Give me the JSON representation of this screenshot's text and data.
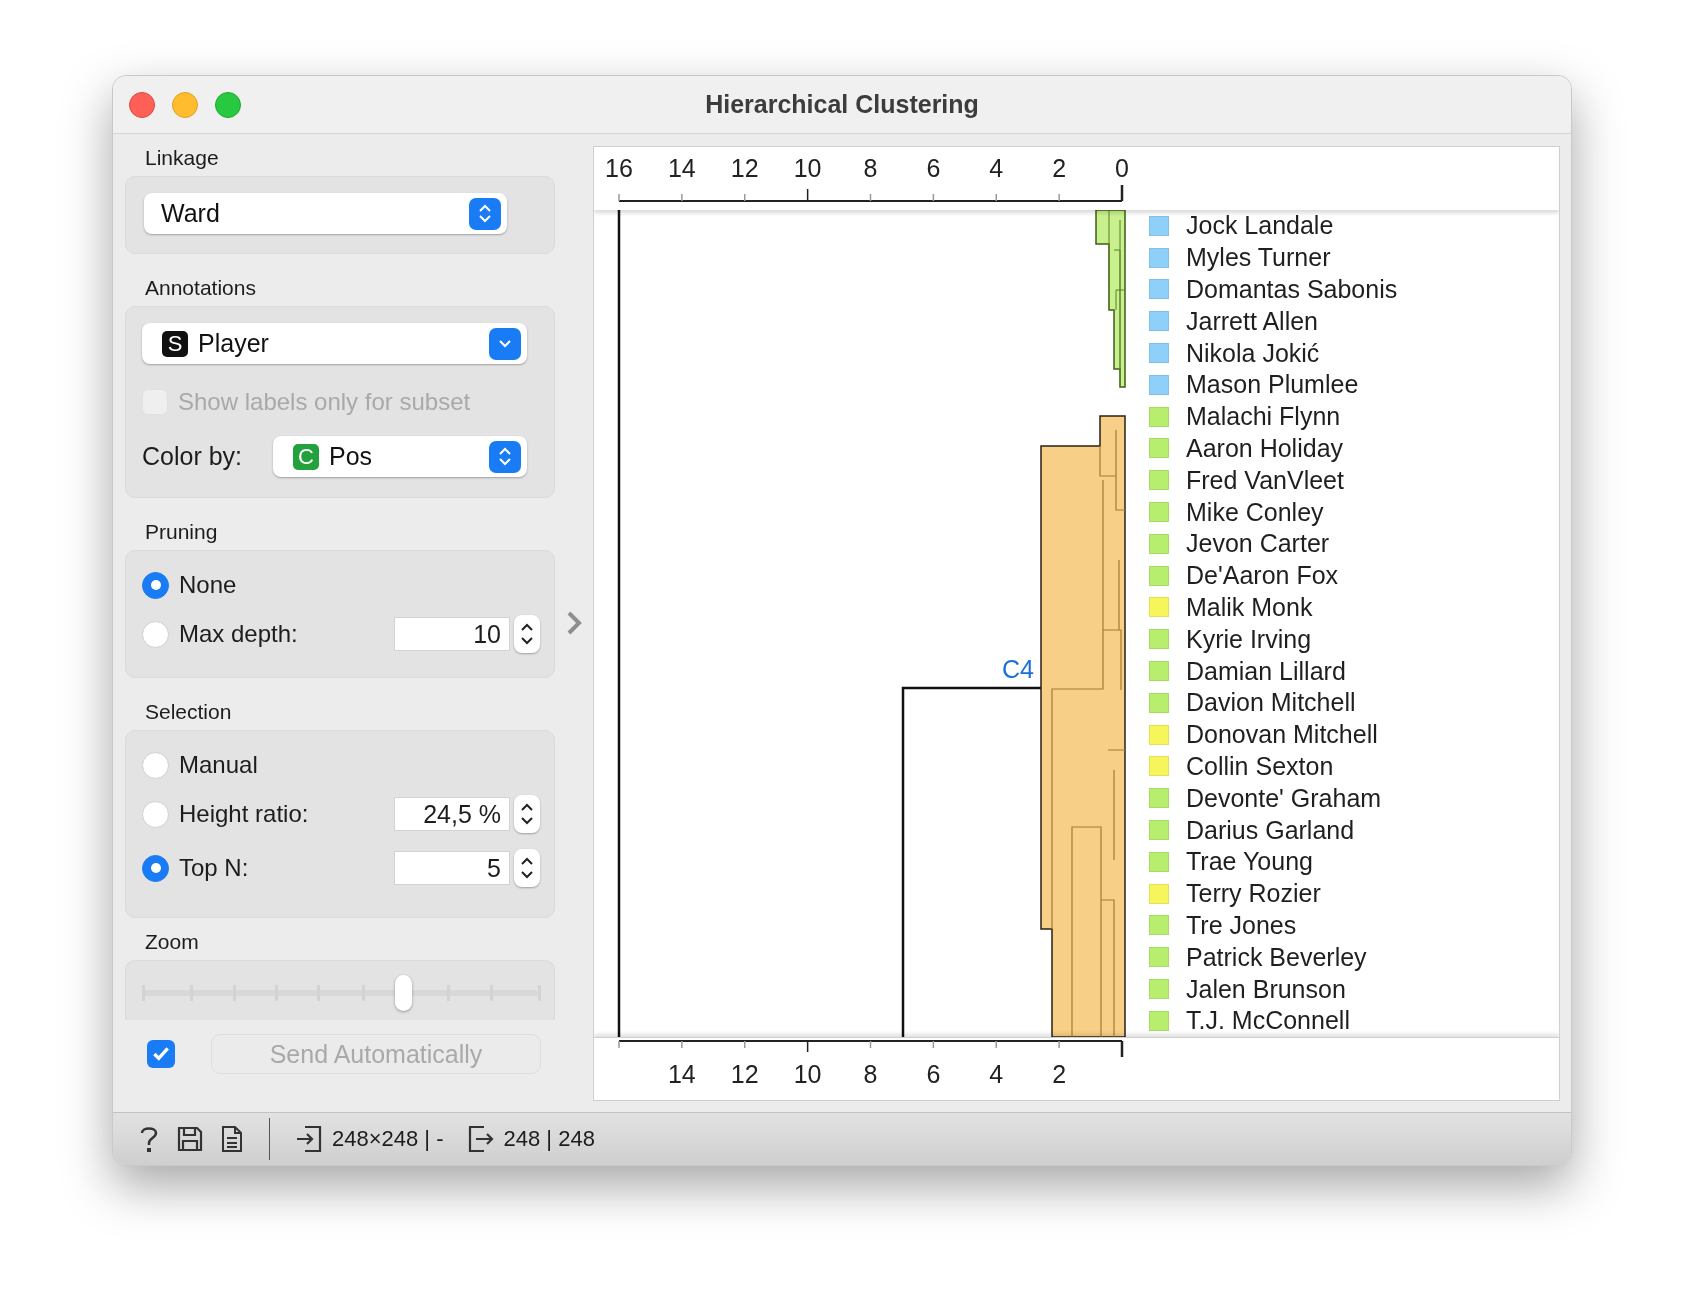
{
  "window": {
    "title": "Hierarchical Clustering"
  },
  "linkage": {
    "label": "Linkage",
    "value": "Ward"
  },
  "annotations": {
    "label": "Annotations",
    "value": "Player",
    "value_badge": "S",
    "show_subset": {
      "label": "Show labels only for subset",
      "checked": false,
      "disabled": true
    },
    "color_by": {
      "label": "Color by:",
      "value": "Pos",
      "value_badge": "C"
    }
  },
  "pruning": {
    "label": "Pruning",
    "options": [
      {
        "label": "None",
        "selected": true
      },
      {
        "label": "Max depth:",
        "selected": false,
        "value": "10"
      }
    ]
  },
  "selection": {
    "label": "Selection",
    "options": [
      {
        "label": "Manual",
        "selected": false
      },
      {
        "label": "Height ratio:",
        "selected": false,
        "value": "24,5 %"
      },
      {
        "label": "Top N:",
        "selected": true,
        "value": "5"
      }
    ]
  },
  "zoom": {
    "label": "Zoom",
    "level": 0.66
  },
  "send": {
    "checked": true,
    "label": "Send Automatically",
    "disabled": true
  },
  "dendrogram": {
    "top_ticks": [
      "16",
      "14",
      "12",
      "10",
      "8",
      "6",
      "4",
      "2",
      "0"
    ],
    "bottom_ticks": [
      "14",
      "12",
      "10",
      "8",
      "6",
      "4",
      "2"
    ],
    "cluster_label": "C4",
    "leaves": [
      {
        "name": "Jock Landale",
        "color": "#8fd0fa"
      },
      {
        "name": "Myles Turner",
        "color": "#8fd0fa"
      },
      {
        "name": "Domantas Sabonis",
        "color": "#8fd0fa"
      },
      {
        "name": "Jarrett Allen",
        "color": "#8fd0fa"
      },
      {
        "name": "Nikola Jokić",
        "color": "#8fd0fa"
      },
      {
        "name": "Mason Plumlee",
        "color": "#8fd0fa"
      },
      {
        "name": "Malachi Flynn",
        "color": "#b8ee6e"
      },
      {
        "name": "Aaron Holiday",
        "color": "#b8ee6e"
      },
      {
        "name": "Fred VanVleet",
        "color": "#b8ee6e"
      },
      {
        "name": "Mike Conley",
        "color": "#b8ee6e"
      },
      {
        "name": "Jevon Carter",
        "color": "#b8ee6e"
      },
      {
        "name": "De'Aaron Fox",
        "color": "#b8ee6e"
      },
      {
        "name": "Malik Monk",
        "color": "#f6f55c"
      },
      {
        "name": "Kyrie Irving",
        "color": "#b8ee6e"
      },
      {
        "name": "Damian Lillard",
        "color": "#b8ee6e"
      },
      {
        "name": "Davion Mitchell",
        "color": "#b8ee6e"
      },
      {
        "name": "Donovan Mitchell",
        "color": "#f6f55c"
      },
      {
        "name": "Collin Sexton",
        "color": "#f6f55c"
      },
      {
        "name": "Devonte' Graham",
        "color": "#b8ee6e"
      },
      {
        "name": "Darius Garland",
        "color": "#b8ee6e"
      },
      {
        "name": "Trae Young",
        "color": "#b8ee6e"
      },
      {
        "name": "Terry Rozier",
        "color": "#f6f55c"
      },
      {
        "name": "Tre Jones",
        "color": "#b8ee6e"
      },
      {
        "name": "Patrick Beverley",
        "color": "#b8ee6e"
      },
      {
        "name": "Jalen Brunson",
        "color": "#b8ee6e"
      },
      {
        "name": "T.J. McConnell",
        "color": "#b8ee6e"
      }
    ]
  },
  "status_bar": {
    "input_summary": "248×248 | -",
    "output_summary": "248 | 248"
  }
}
